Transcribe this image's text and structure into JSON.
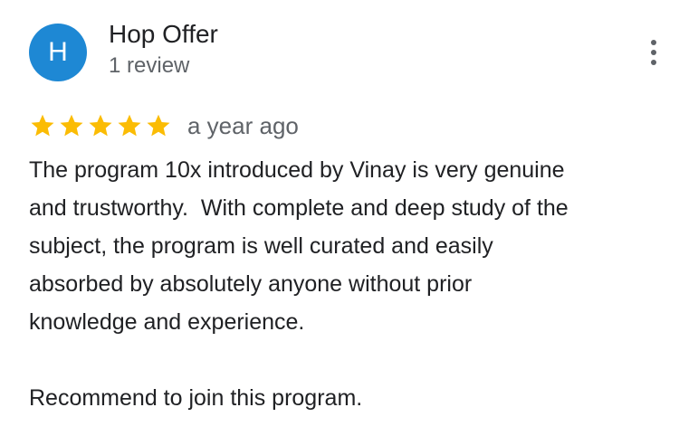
{
  "reviewer": {
    "initial": "H",
    "name": "Hop Offer",
    "review_count": "1 review",
    "avatar_color": "#1e88d4"
  },
  "menu": {
    "icon": "more-vert-icon"
  },
  "review": {
    "rating": 5,
    "rating_max": 5,
    "star_color": "#fbbc04",
    "date": "a year ago",
    "text": "The program 10x introduced by Vinay is very genuine\nand trustworthy.  With complete and deep study of the\nsubject, the program is well curated and easily\nabsorbed by absolutely anyone without prior\nknowledge and experience.\n\nRecommend to join this program."
  }
}
